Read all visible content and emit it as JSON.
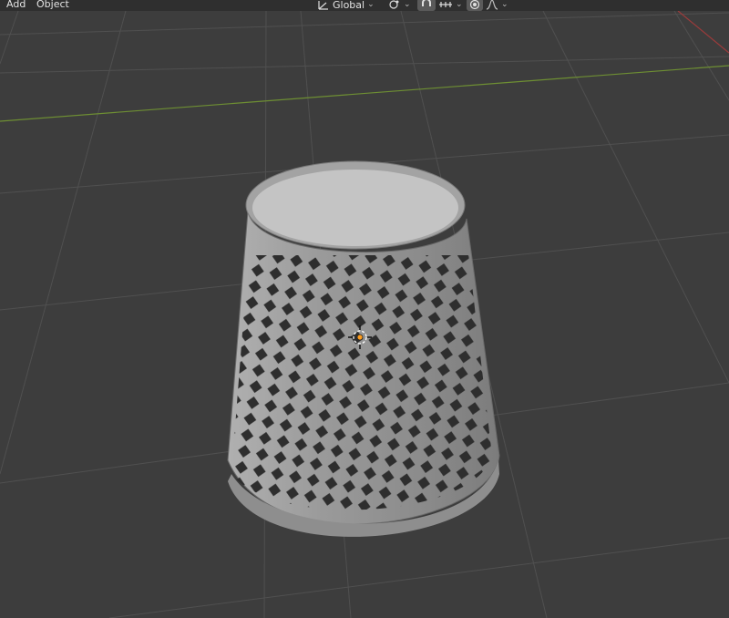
{
  "menu": {
    "add_label": "Add",
    "object_label": "Object"
  },
  "header": {
    "transform_orientation": "Global"
  },
  "icons": {
    "orientation": "transform-orientation-icon",
    "pivot": "pivot-point-icon",
    "snap": "snap-magnet-icon",
    "snap_increment": "snap-increment-icon",
    "proportional": "proportional-editing-icon",
    "falloff": "proportional-falloff-icon",
    "origin": "object-origin-icon"
  },
  "colors": {
    "viewport_bg": "#3d3d3d",
    "grid": "#4f4f4f",
    "x_axis": "#9c3b3b",
    "y_axis": "#6e8f33",
    "mesh": "#9a9a9a",
    "origin": "#ff9e1f"
  }
}
